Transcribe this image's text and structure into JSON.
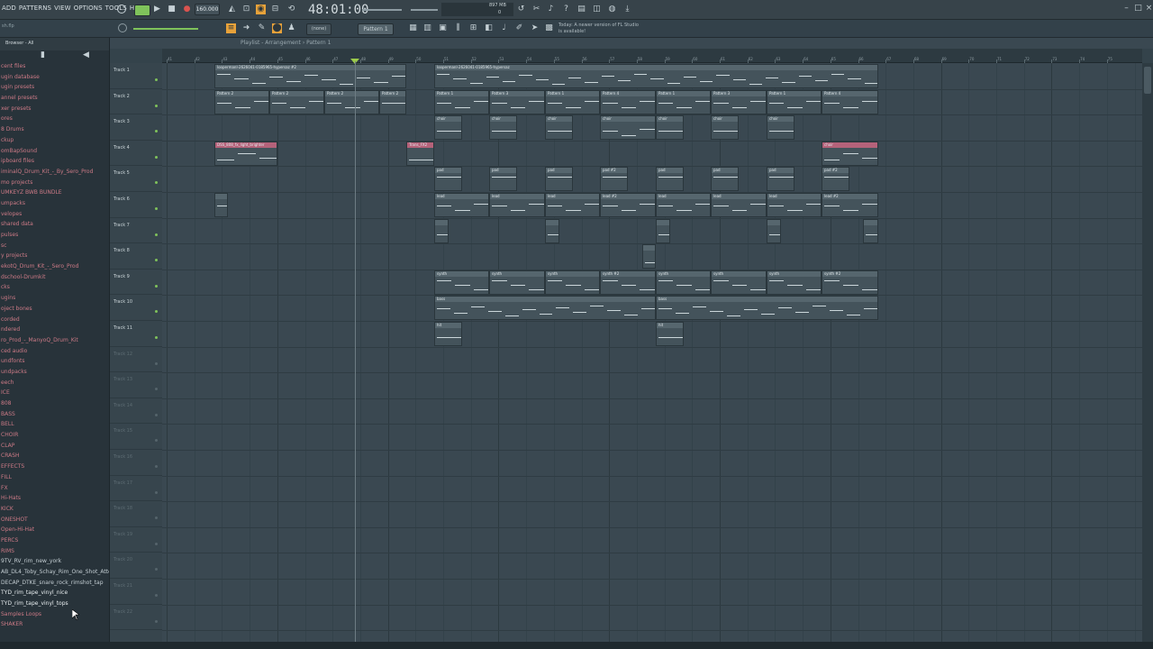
{
  "menu": [
    "ADD",
    "PATTERNS",
    "VIEW",
    "OPTIONS",
    "TOOLS",
    "HELP"
  ],
  "toolbar": {
    "tempo": "160.000",
    "time": "48:01:00",
    "memory": "897 MB",
    "zero": "0",
    "pattern": "Pattern 1",
    "snap": "(none)",
    "hint": "Today: A newer version of FL Studio is available!"
  },
  "browser": {
    "title": "Browser - All",
    "items": [
      {
        "t": "cent files",
        "k": "folder"
      },
      {
        "t": "ugin database",
        "k": "folder"
      },
      {
        "t": "ugin presets",
        "k": "folder"
      },
      {
        "t": "annel presets",
        "k": "folder"
      },
      {
        "t": "xer presets",
        "k": "folder"
      },
      {
        "t": "ores",
        "k": "folder"
      },
      {
        "t": "8 Drums",
        "k": "folder"
      },
      {
        "t": "ckup",
        "k": "folder"
      },
      {
        "t": "omBapSound",
        "k": "folder"
      },
      {
        "t": "ipboard files",
        "k": "folder"
      },
      {
        "t": "iminalQ_Drum_Kit_-_By_Sero_Prod",
        "k": "folder"
      },
      {
        "t": "mo projects",
        "k": "folder"
      },
      {
        "t": "UMKEYZ BWB BUNDLE",
        "k": "folder"
      },
      {
        "t": "umpacks",
        "k": "folder"
      },
      {
        "t": "velopes",
        "k": "folder"
      },
      {
        "t": "shared data",
        "k": "folder"
      },
      {
        "t": "pulses",
        "k": "folder"
      },
      {
        "t": "sc",
        "k": "folder"
      },
      {
        "t": "y projects",
        "k": "folder"
      },
      {
        "t": "ekotQ_Drum_Kit_-_Sero_Prod",
        "k": "folder"
      },
      {
        "t": "dschool-Drumkit",
        "k": "folder"
      },
      {
        "t": "cks",
        "k": "folder"
      },
      {
        "t": "ugins",
        "k": "folder"
      },
      {
        "t": "oject bones",
        "k": "folder"
      },
      {
        "t": "corded",
        "k": "folder"
      },
      {
        "t": "ndered",
        "k": "folder"
      },
      {
        "t": "ro_Prod_-_ManyoQ_Drum_Kit",
        "k": "folder"
      },
      {
        "t": "ced audio",
        "k": "folder"
      },
      {
        "t": "undfonts",
        "k": "folder"
      },
      {
        "t": "undpacks",
        "k": "folder"
      },
      {
        "t": "eech",
        "k": "folder"
      },
      {
        "t": "ICE",
        "k": "folder"
      },
      {
        "t": "808",
        "k": "folder"
      },
      {
        "t": "BASS",
        "k": "folder"
      },
      {
        "t": "BELL",
        "k": "folder"
      },
      {
        "t": "CHOIR",
        "k": "folder"
      },
      {
        "t": "CLAP",
        "k": "folder"
      },
      {
        "t": "CRASH",
        "k": "folder"
      },
      {
        "t": "EFFECTS",
        "k": "folder"
      },
      {
        "t": "FILL",
        "k": "folder"
      },
      {
        "t": "FX",
        "k": "folder"
      },
      {
        "t": "Hi-Hats",
        "k": "folder"
      },
      {
        "t": "KICK",
        "k": "folder"
      },
      {
        "t": "ONESHOT",
        "k": "folder"
      },
      {
        "t": "Open-Hi-Hat",
        "k": "folder"
      },
      {
        "t": "PERCS",
        "k": "folder"
      },
      {
        "t": "RIMS",
        "k": "folder"
      },
      {
        "t": "9TV_RV_rim_new_york",
        "k": "file"
      },
      {
        "t": "AB_DL4_Toby_Schay_Rim_One_Shot_Attentive",
        "k": "file"
      },
      {
        "t": "DECAP_DTKE_snare_rock_rimshot_tap",
        "k": "file"
      },
      {
        "t": "TYD_rim_tape_vinyl_nice",
        "k": "white"
      },
      {
        "t": "TYD_rim_tape_vinyl_tops",
        "k": "white"
      },
      {
        "t": "Samples Loops",
        "k": "folder"
      },
      {
        "t": "SHAKER",
        "k": "folder"
      }
    ]
  },
  "playlist": {
    "title": "Playlist - Arrangement › Pattern 1",
    "tracks": [
      "Track 1",
      "Track 2",
      "Track 3",
      "Track 4",
      "Track 5",
      "Track 6",
      "Track 7",
      "Track 8",
      "Track 9",
      "Track 10",
      "Track 11",
      "Track 12",
      "Track 13",
      "Track 14",
      "Track 15",
      "Track 16",
      "Track 17",
      "Track 18",
      "Track 19",
      "Track 20",
      "Track 21",
      "Track 22"
    ],
    "ruler": [
      "41",
      "42",
      "43",
      "44",
      "45",
      "46",
      "47",
      "48",
      "49",
      "50",
      "51",
      "52",
      "53",
      "54",
      "55",
      "56",
      "57",
      "58",
      "59",
      "60",
      "61",
      "62",
      "63",
      "64",
      "65",
      "66",
      "67",
      "68",
      "69",
      "70",
      "71",
      "72",
      "73",
      "74",
      "75"
    ],
    "clips": [
      {
        "r": 0,
        "a": 58,
        "b": 271,
        "n": "loopermanl-2626041-0185965-hypersaz #2"
      },
      {
        "r": 0,
        "a": 302,
        "b": 795,
        "n": "loopermanl-2626041-0185965-hypersaz"
      },
      {
        "r": 1,
        "a": 58,
        "b": 119,
        "n": "Pattern 2"
      },
      {
        "r": 1,
        "a": 119,
        "b": 180,
        "n": "Pattern 2"
      },
      {
        "r": 1,
        "a": 180,
        "b": 241,
        "n": "Pattern 2"
      },
      {
        "r": 1,
        "a": 241,
        "b": 271,
        "n": "Pattern 2"
      },
      {
        "r": 1,
        "a": 302,
        "b": 363,
        "n": "Pattern 1"
      },
      {
        "r": 1,
        "a": 363,
        "b": 425,
        "n": "Pattern 3"
      },
      {
        "r": 1,
        "a": 425,
        "b": 486,
        "n": "Pattern 1"
      },
      {
        "r": 1,
        "a": 486,
        "b": 548,
        "n": "Pattern 4"
      },
      {
        "r": 1,
        "a": 548,
        "b": 609,
        "n": "Pattern 1"
      },
      {
        "r": 1,
        "a": 609,
        "b": 671,
        "n": "Pattern 3"
      },
      {
        "r": 1,
        "a": 671,
        "b": 732,
        "n": "Pattern 1"
      },
      {
        "r": 1,
        "a": 732,
        "b": 795,
        "n": "Pattern 4"
      },
      {
        "r": 2,
        "a": 302,
        "b": 333,
        "n": "choir"
      },
      {
        "r": 2,
        "a": 363,
        "b": 394,
        "n": "choir"
      },
      {
        "r": 2,
        "a": 425,
        "b": 456,
        "n": "choir"
      },
      {
        "r": 2,
        "a": 486,
        "b": 548,
        "n": "choir"
      },
      {
        "r": 2,
        "a": 548,
        "b": 579,
        "n": "choir"
      },
      {
        "r": 2,
        "a": 609,
        "b": 640,
        "n": "choir"
      },
      {
        "r": 2,
        "a": 671,
        "b": 702,
        "n": "choir"
      },
      {
        "r": 3,
        "a": 58,
        "b": 128,
        "n": "DSS_808_fx_light_brighter"
      },
      {
        "r": 3,
        "a": 271,
        "b": 302,
        "n": "Trans_FX2"
      },
      {
        "r": 3,
        "a": 732,
        "b": 795,
        "n": "choir"
      },
      {
        "r": 4,
        "a": 302,
        "b": 333,
        "n": "pad"
      },
      {
        "r": 4,
        "a": 363,
        "b": 394,
        "n": "pad"
      },
      {
        "r": 4,
        "a": 425,
        "b": 456,
        "n": "pad"
      },
      {
        "r": 4,
        "a": 486,
        "b": 517,
        "n": "pad #2"
      },
      {
        "r": 4,
        "a": 548,
        "b": 579,
        "n": "pad"
      },
      {
        "r": 4,
        "a": 609,
        "b": 640,
        "n": "pad"
      },
      {
        "r": 4,
        "a": 671,
        "b": 702,
        "n": "pad"
      },
      {
        "r": 4,
        "a": 732,
        "b": 763,
        "n": "pad #2"
      },
      {
        "r": 5,
        "a": 58,
        "b": 73,
        "n": ""
      },
      {
        "r": 5,
        "a": 302,
        "b": 363,
        "n": "lead"
      },
      {
        "r": 5,
        "a": 363,
        "b": 425,
        "n": "lead"
      },
      {
        "r": 5,
        "a": 425,
        "b": 486,
        "n": "lead"
      },
      {
        "r": 5,
        "a": 486,
        "b": 548,
        "n": "lead #2"
      },
      {
        "r": 5,
        "a": 548,
        "b": 609,
        "n": "lead"
      },
      {
        "r": 5,
        "a": 609,
        "b": 671,
        "n": "lead"
      },
      {
        "r": 5,
        "a": 671,
        "b": 732,
        "n": "lead"
      },
      {
        "r": 5,
        "a": 732,
        "b": 795,
        "n": "lead #2"
      },
      {
        "r": 6,
        "a": 302,
        "b": 318,
        "n": ""
      },
      {
        "r": 6,
        "a": 425,
        "b": 441,
        "n": ""
      },
      {
        "r": 6,
        "a": 548,
        "b": 564,
        "n": ""
      },
      {
        "r": 6,
        "a": 671,
        "b": 687,
        "n": ""
      },
      {
        "r": 6,
        "a": 778,
        "b": 795,
        "n": ""
      },
      {
        "r": 7,
        "a": 533,
        "b": 548,
        "n": ""
      },
      {
        "r": 8,
        "a": 302,
        "b": 363,
        "n": "synth"
      },
      {
        "r": 8,
        "a": 363,
        "b": 425,
        "n": "synth"
      },
      {
        "r": 8,
        "a": 425,
        "b": 486,
        "n": "synth"
      },
      {
        "r": 8,
        "a": 486,
        "b": 548,
        "n": "synth #2"
      },
      {
        "r": 8,
        "a": 548,
        "b": 609,
        "n": "synth"
      },
      {
        "r": 8,
        "a": 609,
        "b": 671,
        "n": "synth"
      },
      {
        "r": 8,
        "a": 671,
        "b": 732,
        "n": "synth"
      },
      {
        "r": 8,
        "a": 732,
        "b": 795,
        "n": "synth #2"
      },
      {
        "r": 9,
        "a": 302,
        "b": 548,
        "n": "bass"
      },
      {
        "r": 9,
        "a": 548,
        "b": 795,
        "n": "bass"
      },
      {
        "r": 10,
        "a": 302,
        "b": 333,
        "n": "hit"
      },
      {
        "r": 10,
        "a": 548,
        "b": 579,
        "n": "hit"
      }
    ]
  }
}
